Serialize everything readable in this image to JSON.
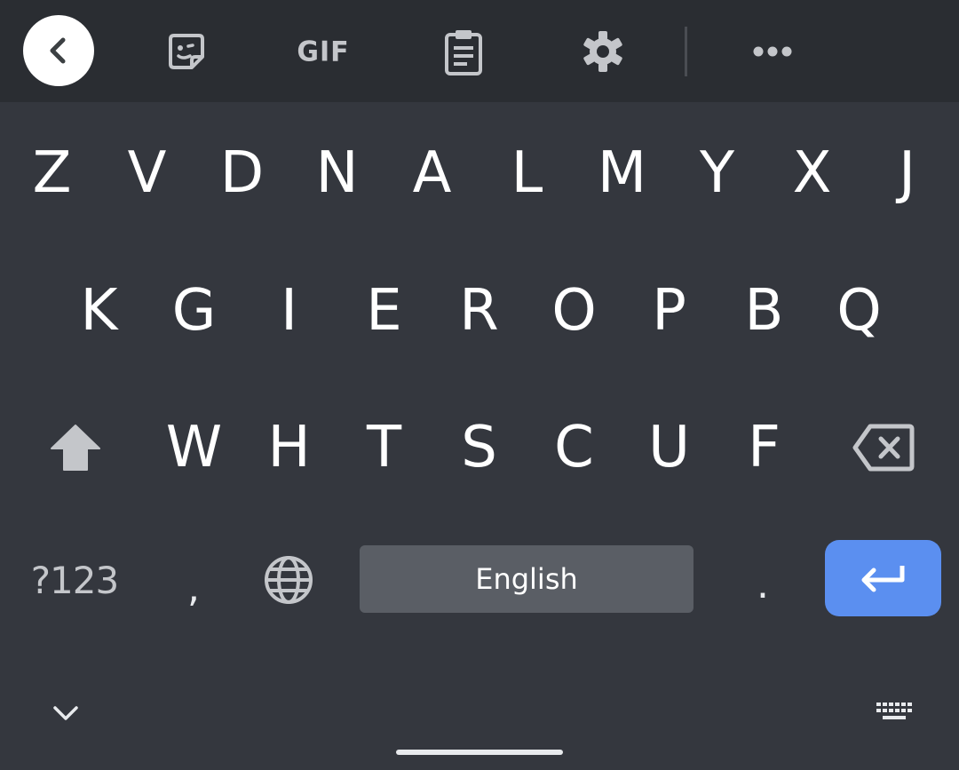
{
  "toolbar": {
    "gif_label": "GIF",
    "icons": [
      "chevron-left-icon",
      "sticker-icon",
      "clipboard-icon",
      "gear-icon",
      "more-horizontal-icon"
    ]
  },
  "keyboard": {
    "row1": [
      "Z",
      "V",
      "D",
      "N",
      "A",
      "L",
      "M",
      "Y",
      "X",
      "J"
    ],
    "row2": [
      "K",
      "G",
      "I",
      "E",
      "R",
      "O",
      "P",
      "B",
      "Q"
    ],
    "row3": [
      "W",
      "H",
      "T",
      "S",
      "C",
      "U",
      "F"
    ],
    "symbols_label": "?123",
    "comma_label": ",",
    "space_label": "English",
    "period_label": ".",
    "function_icons": [
      "shift-icon",
      "backspace-icon",
      "globe-icon",
      "enter-icon",
      "chevron-down-icon",
      "keyboard-icon"
    ]
  },
  "colors": {
    "background": "#34373e",
    "toolbar": "#2a2d32",
    "space_key": "#5a5e65",
    "accent": "#5b8ff0",
    "icon": "#c4c6ca"
  }
}
